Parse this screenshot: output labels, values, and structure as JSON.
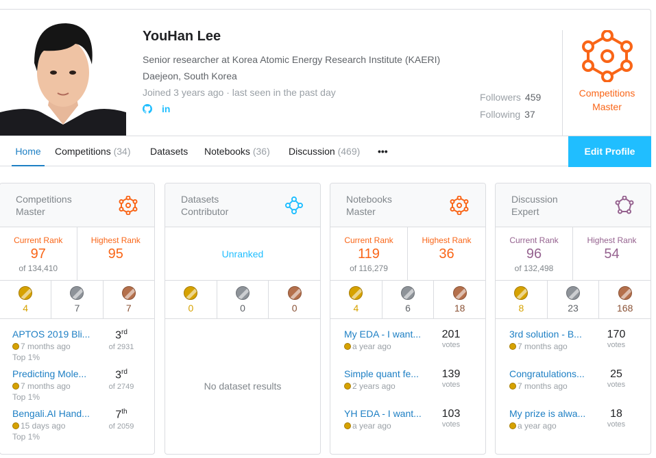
{
  "profile": {
    "name": "YouHan Lee",
    "occupation": "Senior researcher at Korea Atomic Energy Research Institute (KAERI)",
    "location": "Daejeon, South Korea",
    "joined": "Joined 3 years ago · last seen in the past day",
    "social_icons": [
      "github-icon",
      "linkedin-icon"
    ],
    "github_glyph": "⌾",
    "linkedin_glyph": "in"
  },
  "follow": {
    "followers_label": "Followers",
    "followers_count": "459",
    "following_label": "Following",
    "following_count": "37"
  },
  "tier": {
    "line1": "Competitions",
    "line2": "Master",
    "color": "#f96517"
  },
  "tabs": [
    {
      "label": "Home",
      "count": ""
    },
    {
      "label": "Competitions",
      "count": "(34)"
    },
    {
      "label": "Datasets",
      "count": ""
    },
    {
      "label": "Notebooks",
      "count": "(36)"
    },
    {
      "label": "Discussion",
      "count": "(469)"
    },
    {
      "label": "•••",
      "count": ""
    }
  ],
  "edit_profile": "Edit Profile",
  "colors": {
    "accent": "#20beff",
    "link": "#1d7fc4",
    "master": "#f96517",
    "expert": "#95628f",
    "contributor": "#20beff",
    "gold": "#d6a200",
    "silver": "#8e9399",
    "bronze": "#b4704c"
  },
  "cards": [
    {
      "title1": "Competitions",
      "title2": "Master",
      "current_label": "Current Rank",
      "current_rank": "97",
      "of": "of 134,410",
      "highest_label": "Highest Rank",
      "highest_rank": "95",
      "medals": {
        "gold": "4",
        "silver": "7",
        "bronze": "7"
      },
      "items": [
        {
          "title": "APTOS 2019 Bli...",
          "when": "7 months ago",
          "top": "Top 1%",
          "rank": "3",
          "suffix": "rd",
          "of": "of 2931"
        },
        {
          "title": "Predicting Mole...",
          "when": "7 months ago",
          "top": "Top 1%",
          "rank": "3",
          "suffix": "rd",
          "of": "of 2749"
        },
        {
          "title": "Bengali.AI Hand...",
          "when": "15 days ago",
          "top": "Top 1%",
          "rank": "7",
          "suffix": "th",
          "of": "of 2059"
        }
      ]
    },
    {
      "title1": "Datasets",
      "title2": "Contributor",
      "unranked": "Unranked",
      "medals": {
        "gold": "0",
        "silver": "0",
        "bronze": "0"
      },
      "empty": "No dataset results"
    },
    {
      "title1": "Notebooks",
      "title2": "Master",
      "current_label": "Current Rank",
      "current_rank": "119",
      "of": "of 116,279",
      "highest_label": "Highest Rank",
      "highest_rank": "36",
      "medals": {
        "gold": "4",
        "silver": "6",
        "bronze": "18"
      },
      "items": [
        {
          "title": "My EDA - I want...",
          "when": "a year ago",
          "votes": "201",
          "votes_label": "votes"
        },
        {
          "title": "Simple quant fe...",
          "when": "2 years ago",
          "votes": "139",
          "votes_label": "votes"
        },
        {
          "title": "YH EDA - I want...",
          "when": "a year ago",
          "votes": "103",
          "votes_label": "votes"
        }
      ]
    },
    {
      "title1": "Discussion",
      "title2": "Expert",
      "current_label": "Current Rank",
      "current_rank": "96",
      "of": "of 132,498",
      "highest_label": "Highest Rank",
      "highest_rank": "54",
      "medals": {
        "gold": "8",
        "silver": "23",
        "bronze": "168"
      },
      "items": [
        {
          "title": "3rd solution - B...",
          "when": "7 months ago",
          "votes": "170",
          "votes_label": "votes"
        },
        {
          "title": "Congratulations...",
          "when": "7 months ago",
          "votes": "25",
          "votes_label": "votes"
        },
        {
          "title": "My prize is alwa...",
          "when": "a year ago",
          "votes": "18",
          "votes_label": "votes"
        }
      ]
    }
  ]
}
